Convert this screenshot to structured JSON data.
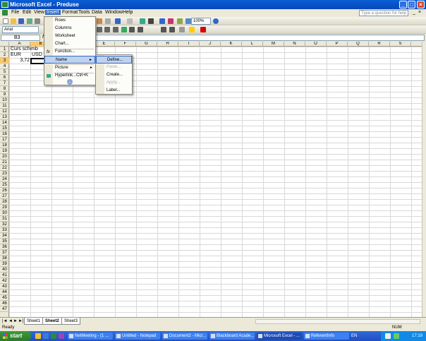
{
  "window": {
    "title": "Microsoft Excel - Preduse",
    "help_placeholder": "Type a question for help"
  },
  "menubar": [
    "File",
    "Edit",
    "View",
    "Insert",
    "Format",
    "Tools",
    "Data",
    "Window",
    "Help"
  ],
  "toolbar": {
    "zoom": "100%",
    "font_name": "Arial"
  },
  "formula_bar": {
    "name_box": "B3",
    "formula": ""
  },
  "columns": [
    "A",
    "B",
    "C",
    "D",
    "E",
    "F",
    "G",
    "H",
    "I",
    "J",
    "K",
    "L",
    "M",
    "N",
    "O",
    "P",
    "Q",
    "R",
    "S"
  ],
  "rows": [
    "1",
    "2",
    "3",
    "4",
    "5",
    "6",
    "7",
    "8",
    "9",
    "10",
    "11",
    "12",
    "13",
    "14",
    "15",
    "16",
    "17",
    "18",
    "19",
    "20",
    "21",
    "22",
    "23",
    "24",
    "25",
    "26",
    "27",
    "28",
    "29",
    "30",
    "31",
    "32",
    "33",
    "34",
    "35",
    "36",
    "37",
    "38",
    "39",
    "40",
    "41",
    "42",
    "43",
    "44",
    "45",
    "46",
    "47"
  ],
  "cells": {
    "a1": "Curs schimb",
    "a2": "EUR",
    "b2": "USD",
    "a3": "3,72"
  },
  "insert_menu": {
    "items": [
      {
        "label": "Rows"
      },
      {
        "label": "Columns"
      },
      {
        "label": "Worksheet"
      },
      {
        "label": "Chart..."
      },
      {
        "label": "Function..."
      },
      {
        "label": "Name"
      },
      {
        "label": "Picture"
      },
      {
        "label": "Hyperlink...",
        "shortcut": "Ctrl+K"
      }
    ]
  },
  "name_submenu": {
    "items": [
      {
        "label": "Define..."
      },
      {
        "label": "Paste..."
      },
      {
        "label": "Create..."
      },
      {
        "label": "Apply..."
      },
      {
        "label": "Label..."
      }
    ]
  },
  "sheets": [
    "Sheet1",
    "Sheet2",
    "Sheet3"
  ],
  "status": {
    "left": "Ready",
    "right": "NUM"
  },
  "taskbar": {
    "start": "start",
    "tasks": [
      "NetMeeting - (1 ...",
      "Untitled - Notepad",
      "Document2 - Micr...",
      "Blackboard Acade...",
      "Microsoft Excel - ...",
      "ReferentInfo"
    ],
    "lang": "EN",
    "clock": "17:19"
  }
}
